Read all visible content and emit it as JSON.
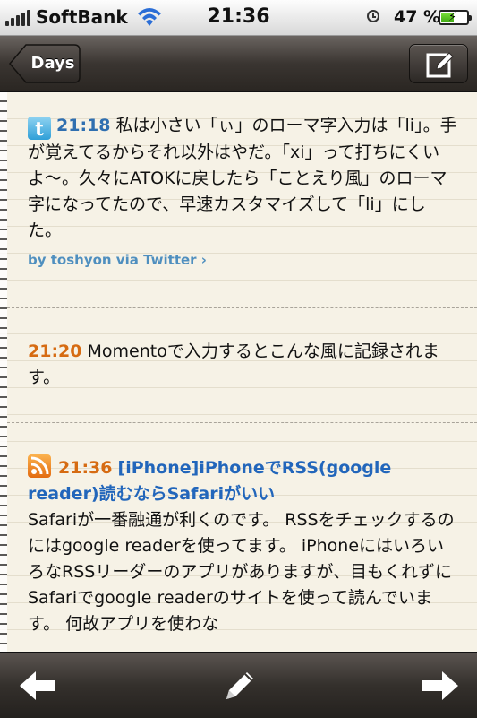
{
  "status_bar": {
    "carrier": "SoftBank",
    "time": "21:36",
    "battery_percent": "47 %",
    "battery_level": 0.47,
    "icons": [
      "signal-bars-icon",
      "wifi-icon",
      "alarm-clock-icon",
      "battery-charging-icon"
    ]
  },
  "nav": {
    "back_label": "Days",
    "compose_icon": "compose-icon"
  },
  "entries": [
    {
      "icon": "twitter-icon",
      "icon_glyph": "t",
      "time": "21:18",
      "text": "私は小さい「ぃ」のローマ字入力は「li」。手が覚えてるからそれ以外はやだ。「xi」って打ちにくいよ〜。久々にATOKに戻したら「ことえり風」のローマ字になってたので、早速カスタマイズして「li」にした。",
      "via": "by toshyon via Twitter ›"
    },
    {
      "time": "21:20",
      "text": "Momentoで入力するとこんな風に記録されます。"
    },
    {
      "icon": "rss-icon",
      "time": "21:36",
      "title": "[iPhone]iPhoneでRSS(google reader)読むならSafariがいい",
      "text": "Safariが一番融通が利くのです。 RSSをチェックするのにはgoogle readerを使ってます。 iPhoneにはいろいろなRSSリーダーのアプリがありますが、目もくれずにSafariでgoogle readerのサイトを使って読んでいます。 何故アプリを使わな"
    }
  ],
  "toolbar": {
    "icons": [
      "arrow-left-icon",
      "pencil-icon",
      "arrow-right-icon"
    ]
  },
  "colors": {
    "time_blue": "#2f6fb0",
    "time_orange": "#d66b12",
    "link": "#2266bb",
    "paper": "#f6f2e6"
  }
}
